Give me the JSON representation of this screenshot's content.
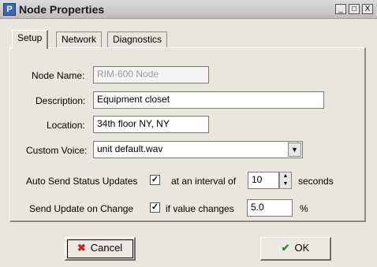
{
  "window": {
    "title": "Node Properties",
    "icon": "node-properties-app-icon"
  },
  "controls": {
    "minimize": "_",
    "maximize": "□",
    "close": "X"
  },
  "tabs": [
    {
      "label": "Setup",
      "active": true
    },
    {
      "label": "Network",
      "active": false
    },
    {
      "label": "Diagnostics",
      "active": false
    }
  ],
  "form": {
    "node_name": {
      "label": "Node Name:",
      "value": "RIM-600 Node",
      "disabled": true
    },
    "description": {
      "label": "Description:",
      "value": "Equipment closet"
    },
    "location": {
      "label": "Location:",
      "value": "34th floor NY, NY"
    },
    "custom_voice": {
      "label": "Custom Voice:",
      "value": "unit default.wav"
    },
    "auto_send": {
      "label": "Auto Send Status Updates",
      "checked": true,
      "interval_label": "at an interval of",
      "interval_value": "10",
      "unit": "seconds"
    },
    "send_on_change": {
      "label": "Send Update on Change",
      "checked": true,
      "condition_label": "if value changes",
      "threshold_value": "5.0",
      "unit": "%"
    }
  },
  "buttons": {
    "cancel": {
      "label": "Cancel",
      "icon": "red-x-icon",
      "color": "#c62828"
    },
    "ok": {
      "label": "OK",
      "icon": "green-checkmark-icon",
      "color": "#2e8b2e"
    }
  }
}
